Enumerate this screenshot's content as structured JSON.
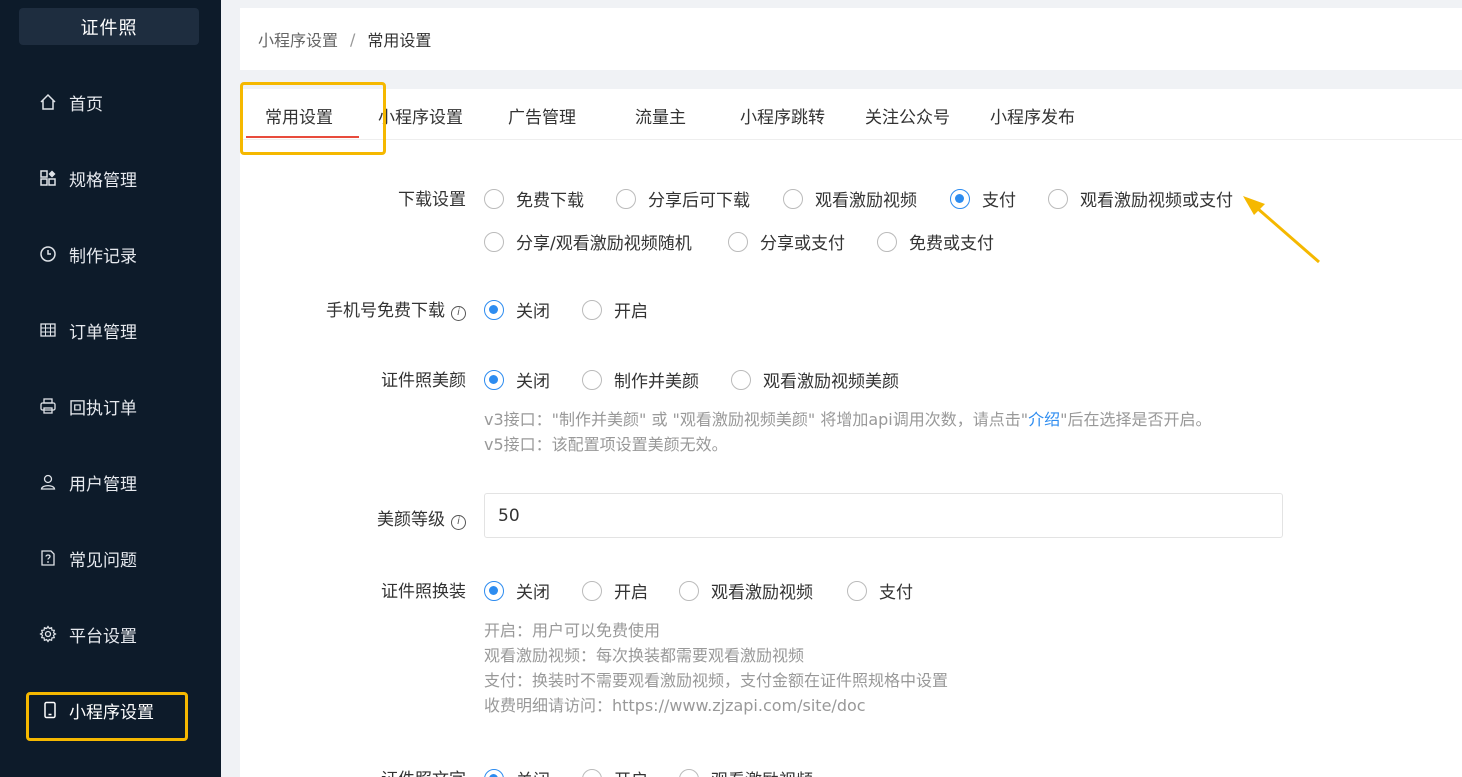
{
  "sidebar": {
    "logo": "证件照",
    "items": [
      {
        "label": "首页",
        "icon": "home-icon"
      },
      {
        "label": "规格管理",
        "icon": "grid-icon"
      },
      {
        "label": "制作记录",
        "icon": "clock-icon"
      },
      {
        "label": "订单管理",
        "icon": "table-icon"
      },
      {
        "label": "回执订单",
        "icon": "printer-icon"
      },
      {
        "label": "用户管理",
        "icon": "user-icon"
      },
      {
        "label": "常见问题",
        "icon": "question-icon"
      },
      {
        "label": "平台设置",
        "icon": "gear-icon"
      },
      {
        "label": "小程序设置",
        "icon": "phone-icon"
      }
    ],
    "active_item": "小程序设置"
  },
  "breadcrumb": {
    "parent": "小程序设置",
    "separator": "/",
    "current": "常用设置"
  },
  "tabs": [
    "常用设置",
    "小程序设置",
    "广告管理",
    "流量主",
    "小程序跳转",
    "关注公众号",
    "小程序发布"
  ],
  "active_tab": "常用设置",
  "form": {
    "download": {
      "label": "下载设置",
      "options": [
        "免费下载",
        "分享后可下载",
        "观看激励视频",
        "支付",
        "观看激励视频或支付",
        "分享/观看激励视频随机",
        "分享或支付",
        "免费或支付"
      ],
      "selected": "支付"
    },
    "phone_free": {
      "label": "手机号免费下载",
      "options": [
        "关闭",
        "开启"
      ],
      "selected": "关闭"
    },
    "beauty": {
      "label": "证件照美颜",
      "options": [
        "关闭",
        "制作并美颜",
        "观看激励视频美颜"
      ],
      "selected": "关闭",
      "hint_line1_before": "v3接口：\"制作并美颜\" 或 \"观看激励视频美颜\" 将增加api调用次数，请点击\"",
      "hint_link": "介绍",
      "hint_line1_after": "\"后在选择是否开启。",
      "hint_line2": "v5接口：该配置项设置美颜无效。"
    },
    "beauty_level": {
      "label": "美颜等级",
      "value": "50"
    },
    "outfit": {
      "label": "证件照换装",
      "options": [
        "关闭",
        "开启",
        "观看激励视频",
        "支付"
      ],
      "selected": "关闭",
      "hints": [
        "开启：用户可以免费使用",
        "观看激励视频：每次换装都需要观看激励视频",
        "支付：换装时不需要观看激励视频，支付金额在证件照规格中设置",
        "收费明细请访问：https://www.zjzapi.com/site/doc"
      ]
    },
    "text": {
      "label": "证件照文字",
      "options": [
        "关闭",
        "开启",
        "观看激励视频"
      ],
      "selected": "关闭"
    }
  },
  "colors": {
    "sidebar_bg": "#0d1b2a",
    "accent": "#2d8cf0",
    "highlight": "#f5b800",
    "tab_underline": "#e84b3c"
  }
}
